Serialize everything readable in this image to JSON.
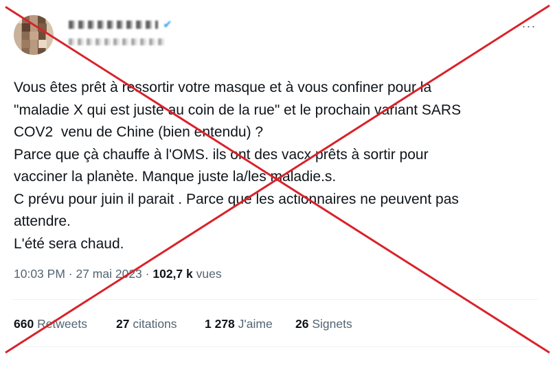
{
  "header": {
    "more_label": "···"
  },
  "tweet": {
    "lines": [
      "Vous êtes prêt à ressortir votre masque et à vous confiner pour la",
      "\"maladie X qui est juste au coin de la rue\" et le prochain variant SARS",
      "COV2  venu de Chine (bien entendu) ?",
      "Parce que çà chauffe à l'OMS. ils ont des vacx prêts à sortir pour",
      "vacciner la planète. Manque juste la/les maladie.s.",
      "C prévu pour juin il parait . Parce que les actionnaires ne peuvent pas",
      "attendre.",
      "L'été sera chaud."
    ]
  },
  "meta": {
    "time": "10:03 PM",
    "separator": " · ",
    "date": "27 mai 2023",
    "views_count": "102,7 k",
    "views_label": " vues"
  },
  "stats": {
    "retweets_count": "660",
    "retweets_label": " Retweets",
    "quotes_count": "27",
    "quotes_label": " citations",
    "likes_count": "1 278",
    "likes_label": " J'aime",
    "bookmarks_count": "26",
    "bookmarks_label": " Signets"
  },
  "colors": {
    "cross": "#d9222a",
    "text": "#0f1419",
    "secondary": "#536471",
    "verified": "#1d9bf0"
  }
}
